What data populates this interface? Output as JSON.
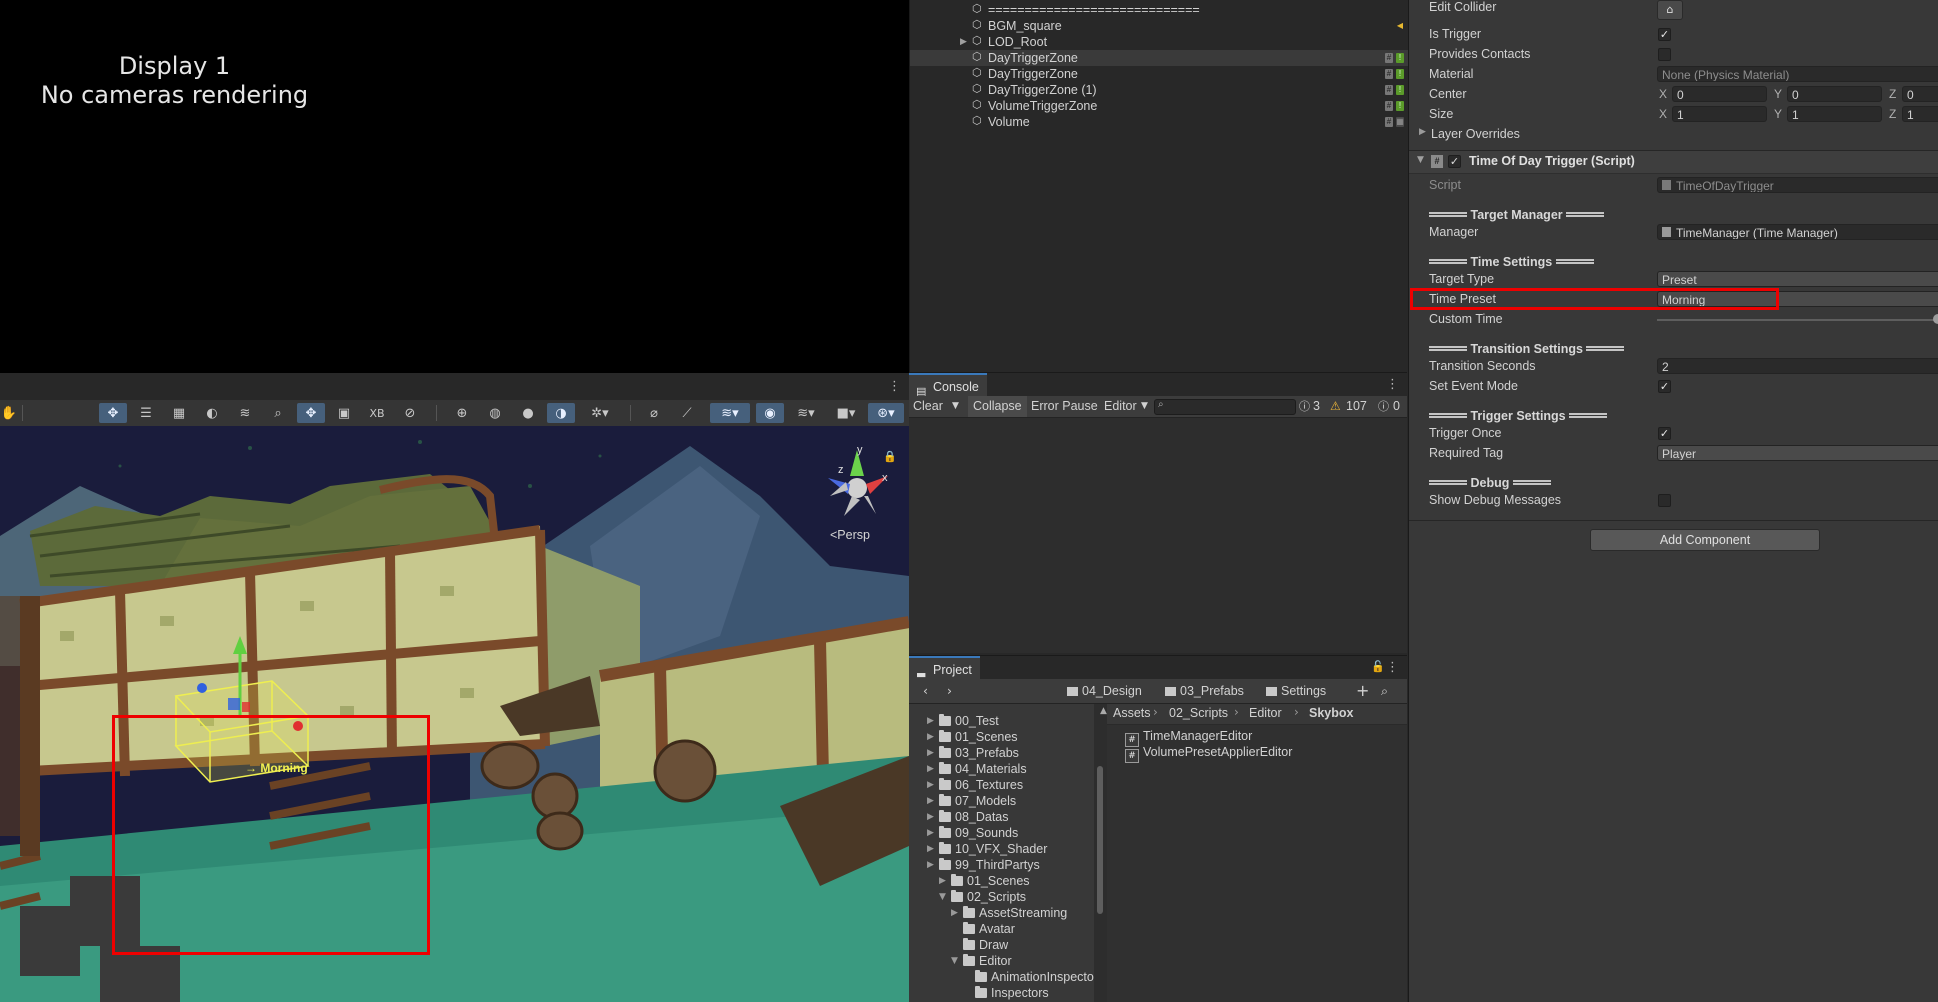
{
  "game_view": {
    "line1": "Display 1",
    "line2": "No cameras rendering"
  },
  "scene_toolbar": {
    "xb_label": "XB",
    "persp_label": "<Persp",
    "gizmo_y": "y",
    "gizmo_x": "x",
    "gizmo_z": "z",
    "trigger_label": "→ Morning"
  },
  "hierarchy": {
    "divider": "=============================",
    "items": [
      {
        "label": "BGM_square",
        "icon": "cube-icon"
      },
      {
        "label": "LOD_Root",
        "icon": "cube-icon"
      },
      {
        "label": "DayTriggerZone",
        "icon": "cube-icon"
      },
      {
        "label": "DayTriggerZone",
        "icon": "cube-icon"
      },
      {
        "label": "DayTriggerZone (1)",
        "icon": "cube-icon"
      },
      {
        "label": "VolumeTriggerZone",
        "icon": "cube-icon"
      },
      {
        "label": "Volume",
        "icon": "cube-icon"
      }
    ]
  },
  "console": {
    "tab": "Console",
    "clear": "Clear",
    "collapse": "Collapse",
    "error_pause": "Error Pause",
    "editor": "Editor",
    "count_info": "3",
    "count_warn": "107",
    "count_error": "0"
  },
  "project": {
    "tab": "Project",
    "crumbs": [
      "04_Design",
      "03_Prefabs",
      "Settings"
    ],
    "path": [
      "Assets",
      "02_Scripts",
      "Editor",
      "Skybox"
    ],
    "tree": [
      {
        "label": "00_Test",
        "indent": 1
      },
      {
        "label": "01_Scenes",
        "indent": 1
      },
      {
        "label": "03_Prefabs",
        "indent": 1
      },
      {
        "label": "04_Materials",
        "indent": 1
      },
      {
        "label": "06_Textures",
        "indent": 1
      },
      {
        "label": "07_Models",
        "indent": 1
      },
      {
        "label": "08_Datas",
        "indent": 1
      },
      {
        "label": "09_Sounds",
        "indent": 1
      },
      {
        "label": "10_VFX_Shader",
        "indent": 1
      },
      {
        "label": "99_ThirdPartys",
        "indent": 1
      },
      {
        "label": "01_Scenes",
        "indent": 0
      },
      {
        "label": "02_Scripts",
        "indent": 0
      },
      {
        "label": "AssetStreaming",
        "indent": 2
      },
      {
        "label": "Avatar",
        "indent": 2
      },
      {
        "label": "Draw",
        "indent": 2
      },
      {
        "label": "Editor",
        "indent": 2
      },
      {
        "label": "AnimationInspector",
        "indent": 3
      },
      {
        "label": "Inspectors",
        "indent": 3
      }
    ],
    "files": [
      "TimeManagerEditor",
      "VolumePresetApplierEditor"
    ]
  },
  "inspector": {
    "edit_collider": "Edit Collider",
    "is_trigger": "Is Trigger",
    "provides_contacts": "Provides Contacts",
    "material_label": "Material",
    "material_value": "None (Physics Material)",
    "center_label": "Center",
    "center": {
      "x": "0",
      "y": "0",
      "z": "0"
    },
    "size_label": "Size",
    "size": {
      "x": "1",
      "y": "1",
      "z": "1"
    },
    "layer_overrides": "Layer Overrides",
    "component_title": "Time Of Day Trigger (Script)",
    "script_label": "Script",
    "script_value": "TimeOfDayTrigger",
    "target_manager_header": "Target Manager",
    "manager_label": "Manager",
    "manager_value": "TimeManager (Time Manager)",
    "time_settings_header": "Time Settings",
    "target_type_label": "Target Type",
    "target_type_value": "Preset",
    "time_preset_label": "Time Preset",
    "time_preset_value": "Morning",
    "custom_time_label": "Custom Time",
    "transition_header": "Transition Settings",
    "transition_seconds_label": "Transition Seconds",
    "transition_seconds_value": "2",
    "set_event_mode_label": "Set Event Mode",
    "trigger_header": "Trigger Settings",
    "trigger_once_label": "Trigger Once",
    "required_tag_label": "Required Tag",
    "required_tag_value": "Player",
    "debug_header": "Debug",
    "show_debug_label": "Show Debug Messages",
    "add_component": "Add Component"
  },
  "colors": {
    "highlight": "#ee0000",
    "tab_accent": "#3a79bb",
    "toolbar_active": "#46607c"
  }
}
